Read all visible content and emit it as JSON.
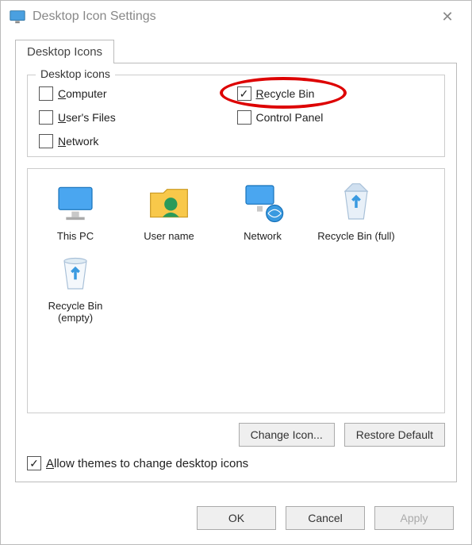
{
  "title": "Desktop Icon Settings",
  "tab": "Desktop Icons",
  "fieldset_legend": "Desktop icons",
  "checks": {
    "computer": {
      "label": "Computer",
      "checked": false
    },
    "recyclebin": {
      "label": "Recycle Bin",
      "checked": true
    },
    "usersfiles": {
      "label": "User's Files",
      "checked": false
    },
    "controlpanel": {
      "label": "Control Panel",
      "checked": false
    },
    "network": {
      "label": "Network",
      "checked": false
    }
  },
  "icons": {
    "thispc": "This PC",
    "username": "User name",
    "network": "Network",
    "recyclebin_full": "Recycle Bin (full)",
    "recyclebin_empty": "Recycle Bin (empty)"
  },
  "btn_change_icon": "Change Icon...",
  "btn_restore_default": "Restore Default",
  "allow_themes": {
    "label": "Allow themes to change desktop icons",
    "checked": true
  },
  "btn_ok": "OK",
  "btn_cancel": "Cancel",
  "btn_apply": "Apply",
  "annotation": "highlight on Recycle Bin checkbox"
}
